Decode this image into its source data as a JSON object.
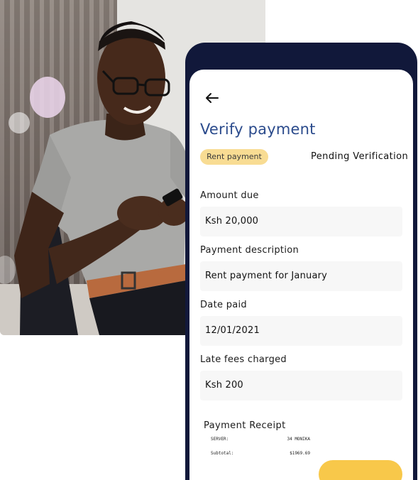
{
  "screen": {
    "title": "Verify payment",
    "category_badge": "Rent payment",
    "status": "Pending Verification"
  },
  "fields": [
    {
      "label": "Amount due",
      "value": "Ksh 20,000"
    },
    {
      "label": "Payment description",
      "value": "Rent payment for January"
    },
    {
      "label": "Date paid",
      "value": "12/01/2021"
    },
    {
      "label": "Late fees charged",
      "value": "Ksh 200"
    }
  ],
  "receipt": {
    "label": "Payment Receipt",
    "rows": [
      {
        "key": "SERVER:",
        "value": "34 MONIKA"
      },
      {
        "key": "Subtotal:",
        "value": "$1969.69"
      }
    ]
  },
  "colors": {
    "phone_frame": "#11183a",
    "title": "#2b4b8c",
    "badge_bg": "#f8dc93",
    "button": "#f8c84a"
  }
}
